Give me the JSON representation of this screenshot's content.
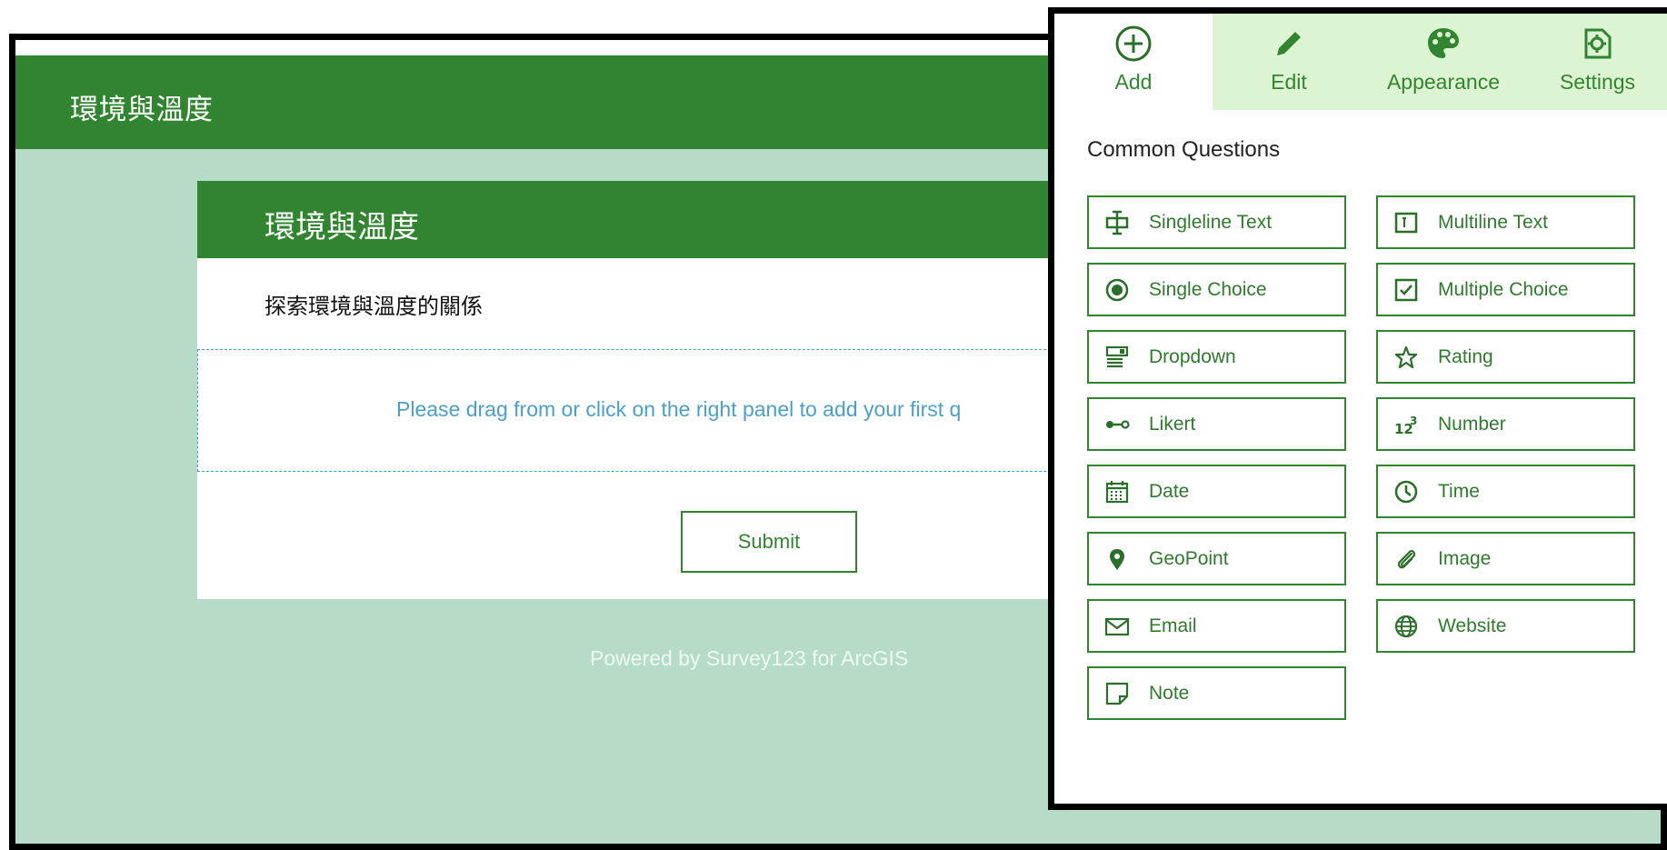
{
  "form": {
    "header_title": "環境與溫度",
    "card_title": "環境與溫度",
    "description": "探索環境與溫度的關係",
    "drop_hint": "Please drag from or click on the right panel to add your first q",
    "submit_label": "Submit",
    "powered_by": "Powered by Survey123 for ArcGIS"
  },
  "panel": {
    "tabs": [
      {
        "label": "Add",
        "icon": "add-circle-icon",
        "active": true
      },
      {
        "label": "Edit",
        "icon": "pencil-icon",
        "active": false
      },
      {
        "label": "Appearance",
        "icon": "palette-icon",
        "active": false
      },
      {
        "label": "Settings",
        "icon": "settings-icon",
        "active": false
      }
    ],
    "section_title": "Common Questions",
    "questions": [
      {
        "label": "Singleline Text",
        "icon": "singleline-text-icon"
      },
      {
        "label": "Multiline Text",
        "icon": "multiline-text-icon"
      },
      {
        "label": "Single Choice",
        "icon": "radio-icon"
      },
      {
        "label": "Multiple Choice",
        "icon": "checkbox-icon"
      },
      {
        "label": "Dropdown",
        "icon": "dropdown-icon"
      },
      {
        "label": "Rating",
        "icon": "star-icon"
      },
      {
        "label": "Likert",
        "icon": "likert-icon"
      },
      {
        "label": "Number",
        "icon": "number-icon"
      },
      {
        "label": "Date",
        "icon": "calendar-icon"
      },
      {
        "label": "Time",
        "icon": "clock-icon"
      },
      {
        "label": "GeoPoint",
        "icon": "map-pin-icon"
      },
      {
        "label": "Image",
        "icon": "paperclip-icon"
      },
      {
        "label": "Email",
        "icon": "envelope-icon"
      },
      {
        "label": "Website",
        "icon": "globe-icon"
      },
      {
        "label": "Note",
        "icon": "note-icon"
      }
    ]
  },
  "colors": {
    "brand_green": "#328530",
    "page_background": "#b6dcc8",
    "tab_background": "#ddf4d3",
    "hint_blue": "#4aa0c8"
  }
}
